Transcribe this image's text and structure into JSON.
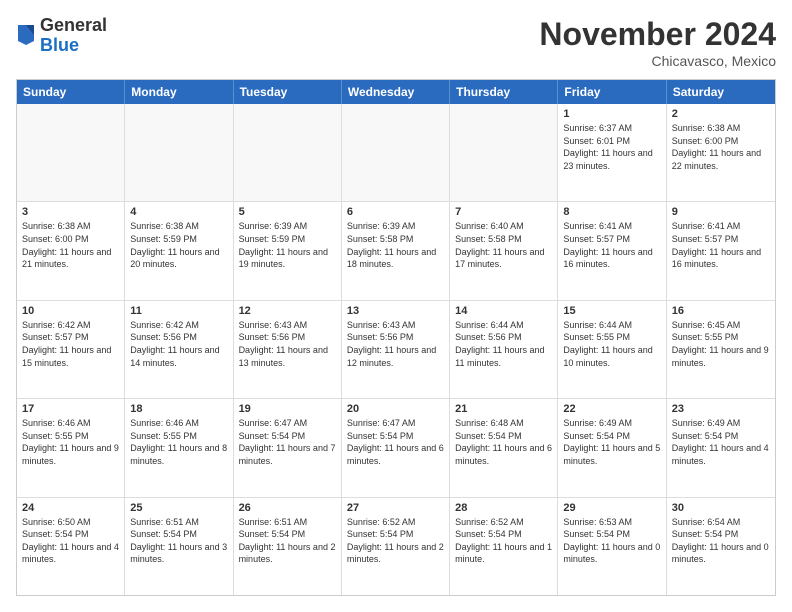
{
  "header": {
    "logo_general": "General",
    "logo_blue": "Blue",
    "month_title": "November 2024",
    "location": "Chicavasco, Mexico"
  },
  "calendar": {
    "days_of_week": [
      "Sunday",
      "Monday",
      "Tuesday",
      "Wednesday",
      "Thursday",
      "Friday",
      "Saturday"
    ],
    "rows": [
      [
        {
          "day": "",
          "empty": true
        },
        {
          "day": "",
          "empty": true
        },
        {
          "day": "",
          "empty": true
        },
        {
          "day": "",
          "empty": true
        },
        {
          "day": "",
          "empty": true
        },
        {
          "day": "1",
          "sunrise": "Sunrise: 6:37 AM",
          "sunset": "Sunset: 6:01 PM",
          "daylight": "Daylight: 11 hours and 23 minutes."
        },
        {
          "day": "2",
          "sunrise": "Sunrise: 6:38 AM",
          "sunset": "Sunset: 6:00 PM",
          "daylight": "Daylight: 11 hours and 22 minutes."
        }
      ],
      [
        {
          "day": "3",
          "sunrise": "Sunrise: 6:38 AM",
          "sunset": "Sunset: 6:00 PM",
          "daylight": "Daylight: 11 hours and 21 minutes."
        },
        {
          "day": "4",
          "sunrise": "Sunrise: 6:38 AM",
          "sunset": "Sunset: 5:59 PM",
          "daylight": "Daylight: 11 hours and 20 minutes."
        },
        {
          "day": "5",
          "sunrise": "Sunrise: 6:39 AM",
          "sunset": "Sunset: 5:59 PM",
          "daylight": "Daylight: 11 hours and 19 minutes."
        },
        {
          "day": "6",
          "sunrise": "Sunrise: 6:39 AM",
          "sunset": "Sunset: 5:58 PM",
          "daylight": "Daylight: 11 hours and 18 minutes."
        },
        {
          "day": "7",
          "sunrise": "Sunrise: 6:40 AM",
          "sunset": "Sunset: 5:58 PM",
          "daylight": "Daylight: 11 hours and 17 minutes."
        },
        {
          "day": "8",
          "sunrise": "Sunrise: 6:41 AM",
          "sunset": "Sunset: 5:57 PM",
          "daylight": "Daylight: 11 hours and 16 minutes."
        },
        {
          "day": "9",
          "sunrise": "Sunrise: 6:41 AM",
          "sunset": "Sunset: 5:57 PM",
          "daylight": "Daylight: 11 hours and 16 minutes."
        }
      ],
      [
        {
          "day": "10",
          "sunrise": "Sunrise: 6:42 AM",
          "sunset": "Sunset: 5:57 PM",
          "daylight": "Daylight: 11 hours and 15 minutes."
        },
        {
          "day": "11",
          "sunrise": "Sunrise: 6:42 AM",
          "sunset": "Sunset: 5:56 PM",
          "daylight": "Daylight: 11 hours and 14 minutes."
        },
        {
          "day": "12",
          "sunrise": "Sunrise: 6:43 AM",
          "sunset": "Sunset: 5:56 PM",
          "daylight": "Daylight: 11 hours and 13 minutes."
        },
        {
          "day": "13",
          "sunrise": "Sunrise: 6:43 AM",
          "sunset": "Sunset: 5:56 PM",
          "daylight": "Daylight: 11 hours and 12 minutes."
        },
        {
          "day": "14",
          "sunrise": "Sunrise: 6:44 AM",
          "sunset": "Sunset: 5:56 PM",
          "daylight": "Daylight: 11 hours and 11 minutes."
        },
        {
          "day": "15",
          "sunrise": "Sunrise: 6:44 AM",
          "sunset": "Sunset: 5:55 PM",
          "daylight": "Daylight: 11 hours and 10 minutes."
        },
        {
          "day": "16",
          "sunrise": "Sunrise: 6:45 AM",
          "sunset": "Sunset: 5:55 PM",
          "daylight": "Daylight: 11 hours and 9 minutes."
        }
      ],
      [
        {
          "day": "17",
          "sunrise": "Sunrise: 6:46 AM",
          "sunset": "Sunset: 5:55 PM",
          "daylight": "Daylight: 11 hours and 9 minutes."
        },
        {
          "day": "18",
          "sunrise": "Sunrise: 6:46 AM",
          "sunset": "Sunset: 5:55 PM",
          "daylight": "Daylight: 11 hours and 8 minutes."
        },
        {
          "day": "19",
          "sunrise": "Sunrise: 6:47 AM",
          "sunset": "Sunset: 5:54 PM",
          "daylight": "Daylight: 11 hours and 7 minutes."
        },
        {
          "day": "20",
          "sunrise": "Sunrise: 6:47 AM",
          "sunset": "Sunset: 5:54 PM",
          "daylight": "Daylight: 11 hours and 6 minutes."
        },
        {
          "day": "21",
          "sunrise": "Sunrise: 6:48 AM",
          "sunset": "Sunset: 5:54 PM",
          "daylight": "Daylight: 11 hours and 6 minutes."
        },
        {
          "day": "22",
          "sunrise": "Sunrise: 6:49 AM",
          "sunset": "Sunset: 5:54 PM",
          "daylight": "Daylight: 11 hours and 5 minutes."
        },
        {
          "day": "23",
          "sunrise": "Sunrise: 6:49 AM",
          "sunset": "Sunset: 5:54 PM",
          "daylight": "Daylight: 11 hours and 4 minutes."
        }
      ],
      [
        {
          "day": "24",
          "sunrise": "Sunrise: 6:50 AM",
          "sunset": "Sunset: 5:54 PM",
          "daylight": "Daylight: 11 hours and 4 minutes."
        },
        {
          "day": "25",
          "sunrise": "Sunrise: 6:51 AM",
          "sunset": "Sunset: 5:54 PM",
          "daylight": "Daylight: 11 hours and 3 minutes."
        },
        {
          "day": "26",
          "sunrise": "Sunrise: 6:51 AM",
          "sunset": "Sunset: 5:54 PM",
          "daylight": "Daylight: 11 hours and 2 minutes."
        },
        {
          "day": "27",
          "sunrise": "Sunrise: 6:52 AM",
          "sunset": "Sunset: 5:54 PM",
          "daylight": "Daylight: 11 hours and 2 minutes."
        },
        {
          "day": "28",
          "sunrise": "Sunrise: 6:52 AM",
          "sunset": "Sunset: 5:54 PM",
          "daylight": "Daylight: 11 hours and 1 minute."
        },
        {
          "day": "29",
          "sunrise": "Sunrise: 6:53 AM",
          "sunset": "Sunset: 5:54 PM",
          "daylight": "Daylight: 11 hours and 0 minutes."
        },
        {
          "day": "30",
          "sunrise": "Sunrise: 6:54 AM",
          "sunset": "Sunset: 5:54 PM",
          "daylight": "Daylight: 11 hours and 0 minutes."
        }
      ]
    ]
  }
}
